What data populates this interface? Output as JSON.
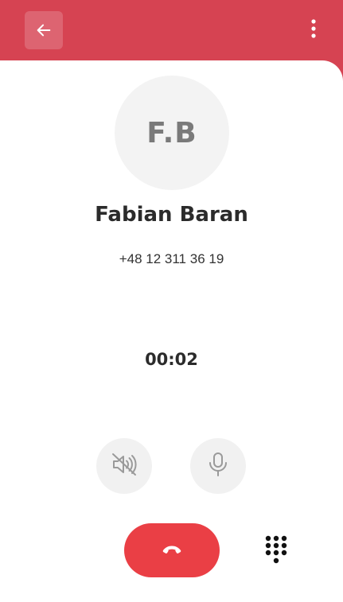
{
  "header": {
    "back_icon": "arrow-left-icon",
    "menu_icon": "more-vertical-icon",
    "background": "#d64352"
  },
  "contact": {
    "initials": "F.B",
    "name": "Fabian Baran",
    "phone": "+48 12 311 36 19"
  },
  "call": {
    "duration": "00:02"
  },
  "controls": {
    "speaker_icon": "speaker-muted-icon",
    "mic_icon": "microphone-icon",
    "hangup_icon": "phone-hangup-icon",
    "hangup_color": "#ea3f45",
    "dialpad_icon": "dialpad-icon"
  }
}
